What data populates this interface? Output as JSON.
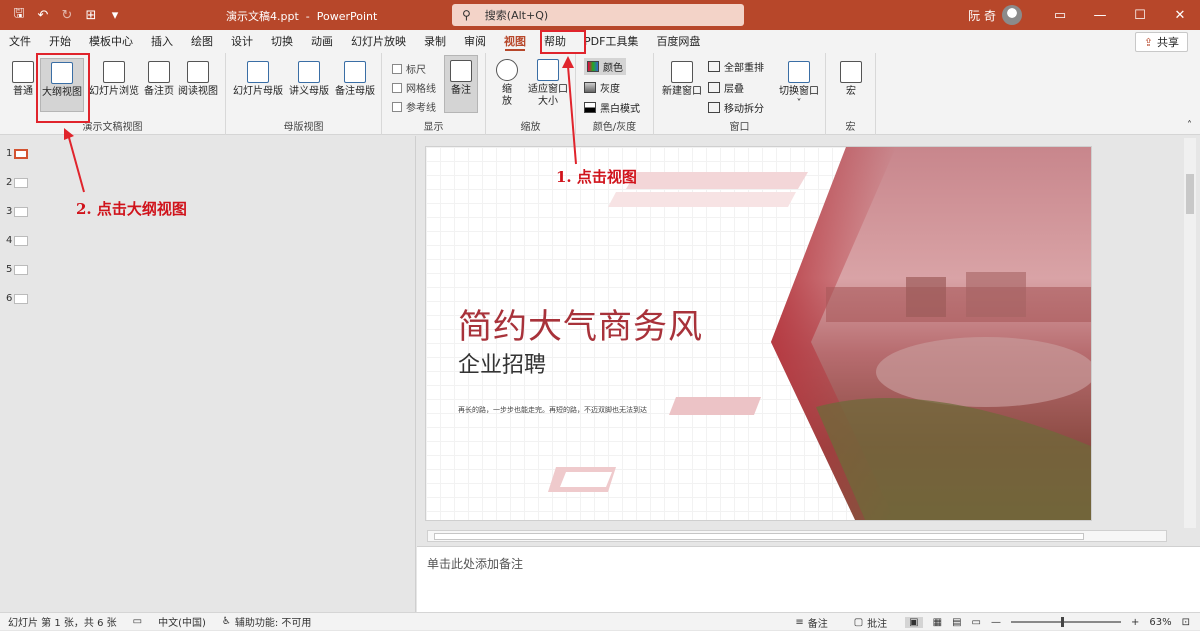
{
  "title_bar": {
    "doc_title": "演示文稿4.ppt",
    "app_name": "PowerPoint",
    "search_placeholder": "搜索(Alt+Q)",
    "user": "阮 奇"
  },
  "menu_tabs": [
    "文件",
    "开始",
    "模板中心",
    "插入",
    "绘图",
    "设计",
    "切换",
    "动画",
    "幻灯片放映",
    "录制",
    "审阅",
    "视图",
    "帮助",
    "PDF工具集",
    "百度网盘"
  ],
  "active_tab": "视图",
  "share_label": "共享",
  "ribbon": {
    "presentation_views": {
      "label": "演示文稿视图",
      "buttons": [
        "普通",
        "大纲视图",
        "幻灯片浏览",
        "备注页",
        "阅读视图"
      ]
    },
    "master_views": {
      "label": "母版视图",
      "buttons": [
        "幻灯片母版",
        "讲义母版",
        "备注母版"
      ]
    },
    "show": {
      "label": "显示",
      "checks": [
        "标尺",
        "网格线",
        "参考线"
      ],
      "notes_button": "备注"
    },
    "zoom": {
      "label": "缩放",
      "zoom_btn": "缩放",
      "fit_btn": "适应窗口大小"
    },
    "color": {
      "label": "颜色/灰度",
      "items": [
        "颜色",
        "灰度",
        "黑白模式"
      ]
    },
    "window": {
      "label": "窗口",
      "new_window": "新建窗口",
      "items": [
        "全部重排",
        "层叠",
        "移动拆分"
      ],
      "switch_window": "切换窗口"
    },
    "macros": {
      "label": "宏",
      "button": "宏"
    }
  },
  "annotations": {
    "step1": "1. 点击视图",
    "step2": "2. 点击大纲视图"
  },
  "slide_numbers": [
    "1",
    "2",
    "3",
    "4",
    "5",
    "6"
  ],
  "slide": {
    "title": "简约大气商务风",
    "subtitle": "企业招聘",
    "caption": "再长的路，一步步也能走完。再短的路，不迈双脚也无法到达"
  },
  "notes_placeholder": "单击此处添加备注",
  "status_bar": {
    "slide_info": "幻灯片 第 1 张，共 6 张",
    "language": "中文(中国)",
    "accessibility": "辅助功能: 不可用",
    "notes": "备注",
    "comments": "批注",
    "zoom": "63%"
  },
  "colors": {
    "brand": "#b7472a",
    "annotation": "#e0242c",
    "slide_accent": "#b5343c"
  }
}
